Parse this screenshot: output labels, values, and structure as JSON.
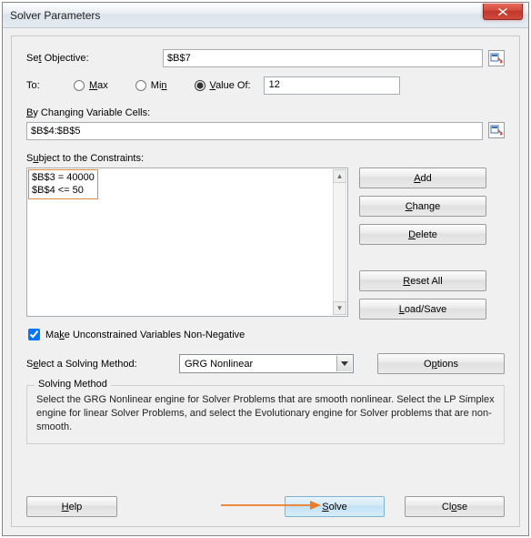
{
  "window": {
    "title": "Solver Parameters"
  },
  "labels": {
    "set_objective_prefix": "Se",
    "set_objective_ul": "t",
    "set_objective_suffix": " Objective:",
    "to": "To:",
    "max_ul": "M",
    "max_suffix": "ax",
    "min_prefix": "Mi",
    "min_ul": "n",
    "valueof_ul": "V",
    "valueof_suffix": "alue Of:",
    "by_cells_ul": "B",
    "by_cells_suffix": "y Changing Variable Cells:",
    "subject_prefix": "S",
    "subject_ul": "u",
    "subject_suffix": "bject to the Constraints:",
    "make_prefix": "Ma",
    "make_ul": "k",
    "make_suffix": "e Unconstrained Variables Non-Negative",
    "select_method_prefix": "S",
    "select_method_ul": "e",
    "select_method_suffix": "lect a Solving Method:",
    "solving_method_legend": "Solving Method",
    "desc": "Select the GRG Nonlinear engine for Solver Problems that are smooth nonlinear. Select the LP Simplex engine for linear Solver Problems, and select the Evolutionary engine for Solver problems that are non-smooth."
  },
  "values": {
    "objective": "$B$7",
    "value_of": "12",
    "changing_cells": "$B$4:$B$5",
    "constraints": [
      "$B$3 = 40000",
      "$B$4 <= 50"
    ],
    "method": "GRG Nonlinear",
    "make_nonneg": true
  },
  "buttons": {
    "add_ul": "A",
    "add_suffix": "dd",
    "change_ul": "C",
    "change_suffix": "hange",
    "delete_ul": "D",
    "delete_suffix": "elete",
    "reset_ul": "R",
    "reset_suffix": "eset All",
    "loadsave_ul": "L",
    "loadsave_suffix": "oad/Save",
    "options_prefix": "O",
    "options_ul": "p",
    "options_suffix": "tions",
    "help_ul": "H",
    "help_suffix": "elp",
    "solve_ul": "S",
    "solve_suffix": "olve",
    "close_prefix": "Cl",
    "close_ul": "o",
    "close_suffix": "se"
  }
}
